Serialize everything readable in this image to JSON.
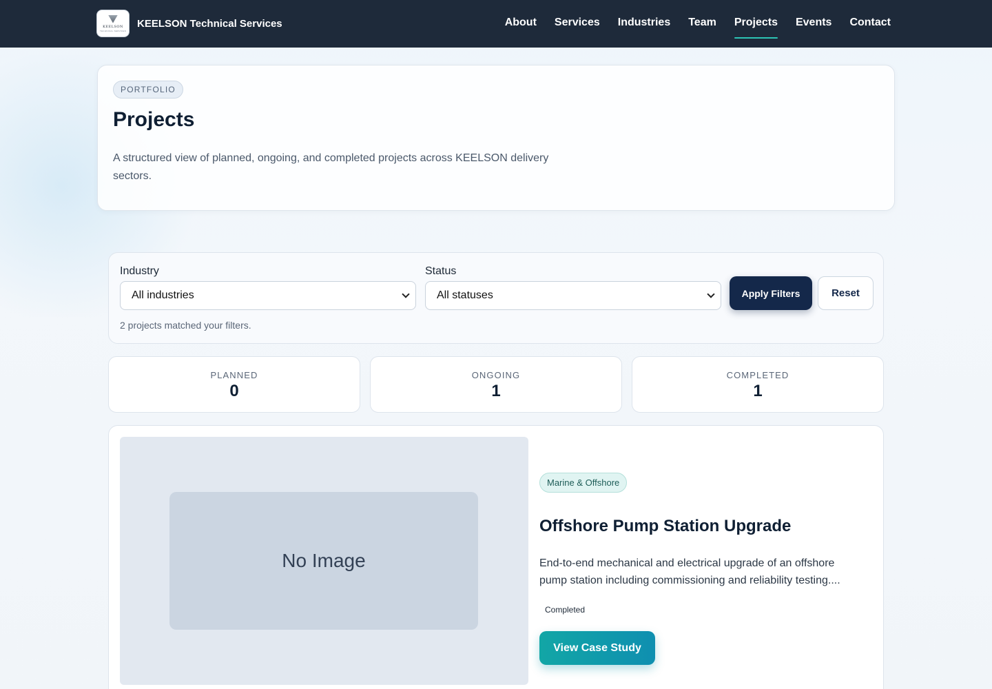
{
  "header": {
    "brand_name": "KEELSON Technical Services",
    "logo_text": "KEELSON",
    "logo_subtext": "TECHNICAL SERVICES",
    "nav": [
      {
        "label": "About"
      },
      {
        "label": "Services"
      },
      {
        "label": "Industries"
      },
      {
        "label": "Team"
      },
      {
        "label": "Projects",
        "active": true
      },
      {
        "label": "Events"
      },
      {
        "label": "Contact"
      }
    ],
    "active_underline_color": "#2cc5b5",
    "background_color": "#1e2a3a"
  },
  "hero": {
    "badge": "PORTFOLIO",
    "title": "Projects",
    "description": "A structured view of planned, ongoing, and completed projects across KEELSON delivery sectors."
  },
  "filters": {
    "industry_label": "Industry",
    "industry_value": "All industries",
    "status_label": "Status",
    "status_value": "All statuses",
    "apply_label": "Apply Filters",
    "reset_label": "Reset",
    "match_text": "2 projects matched your filters."
  },
  "stats": [
    {
      "label": "PLANNED",
      "value": "0"
    },
    {
      "label": "ONGOING",
      "value": "1"
    },
    {
      "label": "COMPLETED",
      "value": "1"
    }
  ],
  "project": {
    "image_placeholder": "No Image",
    "industry_tag": "Marine & Offshore",
    "title": "Offshore Pump Station Upgrade",
    "description": "End-to-end mechanical and electrical upgrade of an offshore pump station including commissioning and reliability testing....",
    "status": "Completed",
    "cta_label": "View Case Study",
    "cta_color": "#12a6a6"
  }
}
